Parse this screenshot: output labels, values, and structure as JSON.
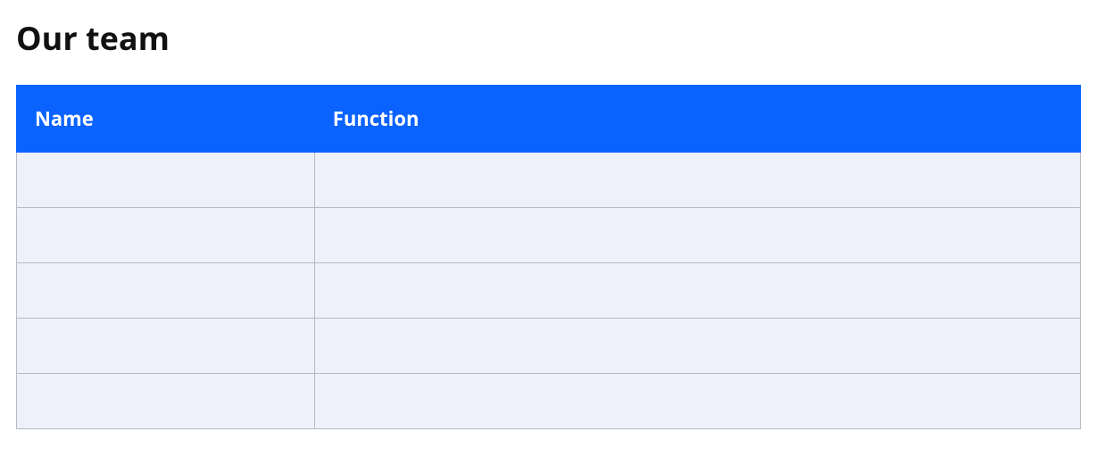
{
  "title": "Our team",
  "table": {
    "headers": {
      "name": "Name",
      "function": "Function"
    },
    "rows": [
      {
        "name": "",
        "function": ""
      },
      {
        "name": "",
        "function": ""
      },
      {
        "name": "",
        "function": ""
      },
      {
        "name": "",
        "function": ""
      },
      {
        "name": "",
        "function": ""
      }
    ]
  }
}
